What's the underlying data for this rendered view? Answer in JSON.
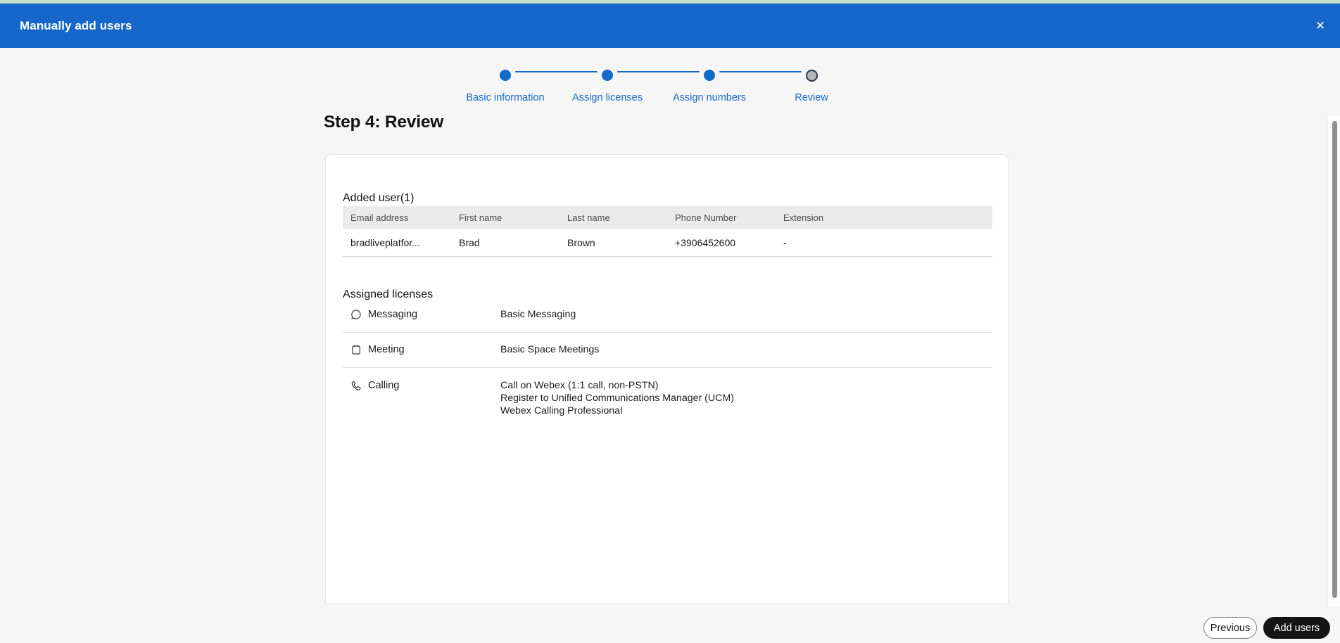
{
  "window": {
    "title": "Manually add users",
    "close_glyph": "✕"
  },
  "colors": {
    "header_bg": "#1566c8",
    "top_strip": "#c5ddc3",
    "accent_blue": "#1569c8",
    "page_bg": "#f6f6f6",
    "current_step_fill": "#b9b9b9",
    "current_step_ring": "#2a3648",
    "add_button_bg": "#141414"
  },
  "stepper": {
    "steps": [
      {
        "label": "Basic information",
        "state": "complete"
      },
      {
        "label": "Assign licenses",
        "state": "complete"
      },
      {
        "label": "Assign numbers",
        "state": "complete"
      },
      {
        "label": "Review",
        "state": "current"
      }
    ]
  },
  "page": {
    "heading": "Step 4: Review"
  },
  "added_users": {
    "title": "Added user(1)",
    "columns": [
      "Email address",
      "First name",
      "Last name",
      "Phone Number",
      "Extension"
    ],
    "rows": [
      [
        "bradliveplatfor...",
        "Brad",
        "Brown",
        "+3906452600",
        "-"
      ]
    ]
  },
  "assigned_licenses": {
    "title": "Assigned licenses",
    "items": [
      {
        "icon": "chat-bubble-icon",
        "label": "Messaging",
        "values": [
          "Basic Messaging"
        ]
      },
      {
        "icon": "calendar-icon",
        "label": "Meeting",
        "values": [
          "Basic Space Meetings"
        ]
      },
      {
        "icon": "phone-handset-icon",
        "label": "Calling",
        "values": [
          "Call on Webex (1:1 call, non-PSTN)",
          "Register to Unified Communications Manager (UCM)",
          "Webex Calling Professional"
        ]
      }
    ]
  },
  "footer": {
    "previous_label": "Previous",
    "add_users_label": "Add users"
  }
}
